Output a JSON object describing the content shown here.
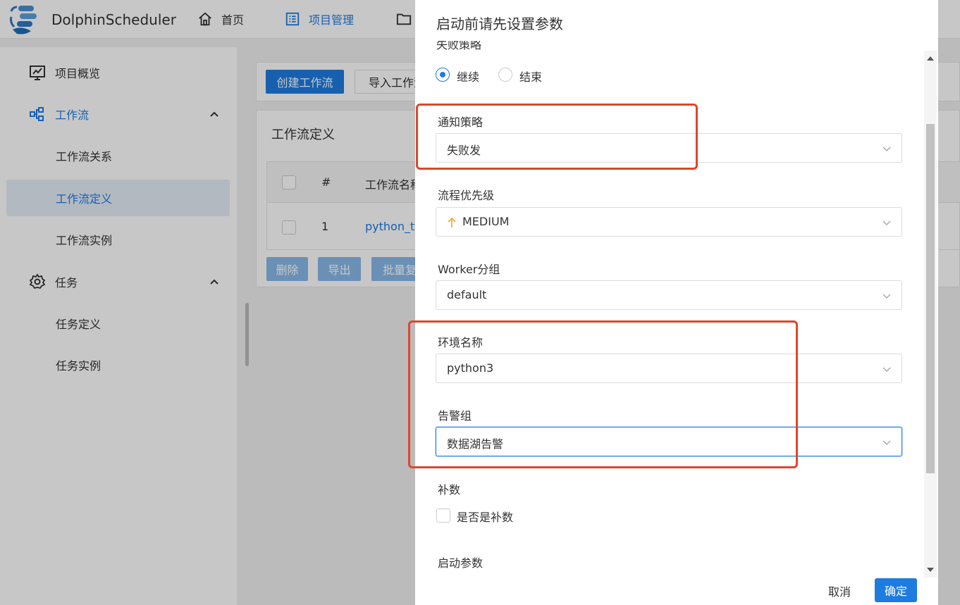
{
  "app": {
    "brand": "DolphinScheduler"
  },
  "topnav": {
    "home": "首页",
    "project": "项目管理"
  },
  "sidebar": {
    "overview": "项目概览",
    "workflow": "工作流",
    "workflow_relation": "工作流关系",
    "workflow_definition": "工作流定义",
    "workflow_instance": "工作流实例",
    "task": "任务",
    "task_definition": "任务定义",
    "task_instance": "任务实例"
  },
  "toolbar": {
    "create": "创建工作流",
    "import": "导入工作流"
  },
  "card": {
    "title": "工作流定义",
    "col_index": "#",
    "col_name": "工作流名称",
    "row_index": "1",
    "row_name": "python_t",
    "btn_delete": "删除",
    "btn_export": "导出",
    "btn_batch": "批量复"
  },
  "modal": {
    "title": "启动前请先设置参数",
    "cut_label": "失败策略",
    "radio_continue": "继续",
    "radio_end": "结束",
    "notify_label": "通知策略",
    "notify_value": "失败发",
    "priority_label": "流程优先级",
    "priority_value": "MEDIUM",
    "worker_label": "Worker分组",
    "worker_value": "default",
    "env_label": "环境名称",
    "env_value": "python3",
    "alarm_label": "告警组",
    "alarm_value": "数据湖告警",
    "complement_label": "补数",
    "complement_checkbox": "是否是补数",
    "startup_params_label": "启动参数",
    "cancel": "取消",
    "ok": "确定"
  },
  "colors": {
    "primary": "#1e7be0",
    "highlight": "#e0452b",
    "priority_arrow": "#f5a623"
  }
}
